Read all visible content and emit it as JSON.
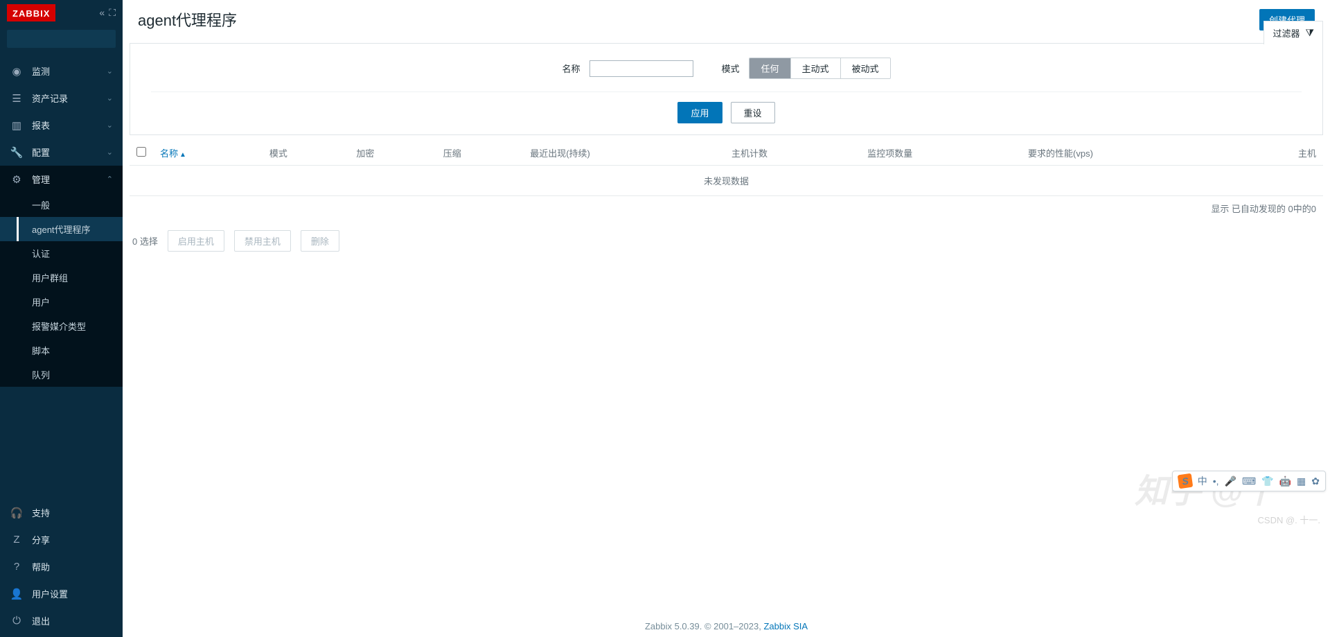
{
  "logo": "ZABBIX",
  "sidebar": {
    "search_placeholder": "",
    "items": [
      {
        "label": "监测",
        "icon": "◉"
      },
      {
        "label": "资产记录",
        "icon": "☰"
      },
      {
        "label": "报表",
        "icon": "⬛"
      },
      {
        "label": "配置",
        "icon": "🔧"
      },
      {
        "label": "管理",
        "icon": "⚙"
      }
    ],
    "sub": [
      {
        "label": "一般"
      },
      {
        "label": "agent代理程序"
      },
      {
        "label": "认证"
      },
      {
        "label": "用户群组"
      },
      {
        "label": "用户"
      },
      {
        "label": "报警媒介类型"
      },
      {
        "label": "脚本"
      },
      {
        "label": "队列"
      }
    ],
    "bottom": [
      {
        "label": "支持",
        "icon": "🎧"
      },
      {
        "label": "分享",
        "icon": "Z"
      },
      {
        "label": "帮助",
        "icon": "?"
      },
      {
        "label": "用户设置",
        "icon": "👤"
      },
      {
        "label": "退出",
        "icon": "⏻"
      }
    ]
  },
  "header": {
    "title": "agent代理程序",
    "create_btn": "创建代理"
  },
  "filter": {
    "tab_label": "过滤器",
    "name_label": "名称",
    "name_value": "",
    "mode_label": "模式",
    "mode_options": [
      "任何",
      "主动式",
      "被动式"
    ],
    "apply": "应用",
    "reset": "重设"
  },
  "table": {
    "cols": [
      "名称",
      "模式",
      "加密",
      "压缩",
      "最近出现(持续)",
      "主机计数",
      "监控项数量",
      "要求的性能(vps)",
      "主机"
    ],
    "empty": "未发现数据",
    "footer": "显示 已自动发现的 0中的0"
  },
  "bulk": {
    "count": "0 选择",
    "enable": "启用主机",
    "disable": "禁用主机",
    "delete": "删除"
  },
  "footer": {
    "text": "Zabbix 5.0.39. © 2001–2023, ",
    "link": "Zabbix SIA"
  },
  "watermark": "知乎 @十一",
  "csdn": "CSDN @. 十一.",
  "ime": {
    "s": "S",
    "lang": "中"
  }
}
